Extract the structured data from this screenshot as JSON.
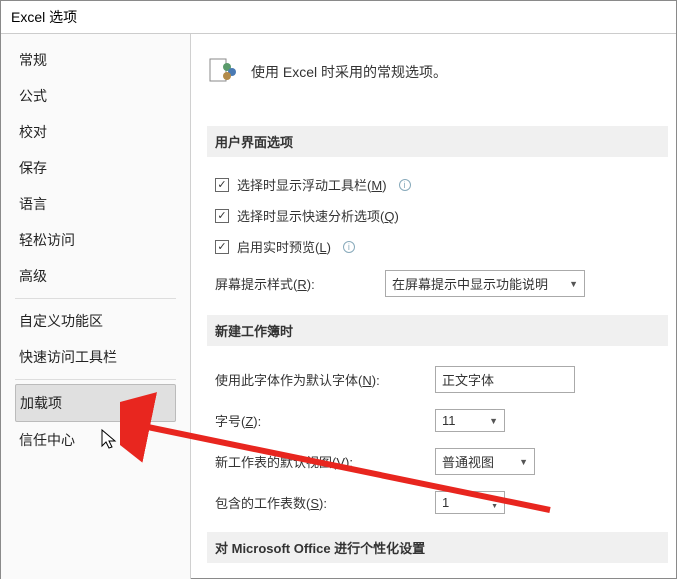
{
  "title": "Excel 选项",
  "sidebar": {
    "items": [
      {
        "label": "常规"
      },
      {
        "label": "公式"
      },
      {
        "label": "校对"
      },
      {
        "label": "保存"
      },
      {
        "label": "语言"
      },
      {
        "label": "轻松访问"
      },
      {
        "label": "高级"
      },
      {
        "label": "自定义功能区"
      },
      {
        "label": "快速访问工具栏"
      },
      {
        "label": "加载项"
      },
      {
        "label": "信任中心"
      }
    ],
    "selected_index": 9
  },
  "main": {
    "header": "使用 Excel 时采用的常规选项。",
    "sections": {
      "ui_options": {
        "title": "用户界面选项",
        "checks": [
          {
            "checked": true,
            "label_pre": "选择时显示浮动工具栏(",
            "key": "M",
            "label_post": ")",
            "info": true
          },
          {
            "checked": true,
            "label_pre": "选择时显示快速分析选项(",
            "key": "Q",
            "label_post": ")",
            "info": false
          },
          {
            "checked": true,
            "label_pre": "启用实时预览(",
            "key": "L",
            "label_post": ")",
            "info": true
          }
        ],
        "screen_tip": {
          "label_pre": "屏幕提示样式(",
          "key": "R",
          "label_post": "):",
          "value": "在屏幕提示中显示功能说明"
        }
      },
      "new_workbook": {
        "title": "新建工作簿时",
        "default_font": {
          "label_pre": "使用此字体作为默认字体(",
          "key": "N",
          "label_post": "):",
          "value": "正文字体"
        },
        "font_size": {
          "label_pre": "字号(",
          "key": "Z",
          "label_post": "):",
          "value": "11"
        },
        "default_view": {
          "label_pre": "新工作表的默认视图(",
          "key": "V",
          "label_post": "):",
          "value": "普通视图"
        },
        "sheet_count": {
          "label_pre": "包含的工作表数(",
          "key": "S",
          "label_post": "):",
          "value": "1"
        }
      },
      "personalize": {
        "title": "对 Microsoft Office 进行个性化设置"
      }
    }
  }
}
